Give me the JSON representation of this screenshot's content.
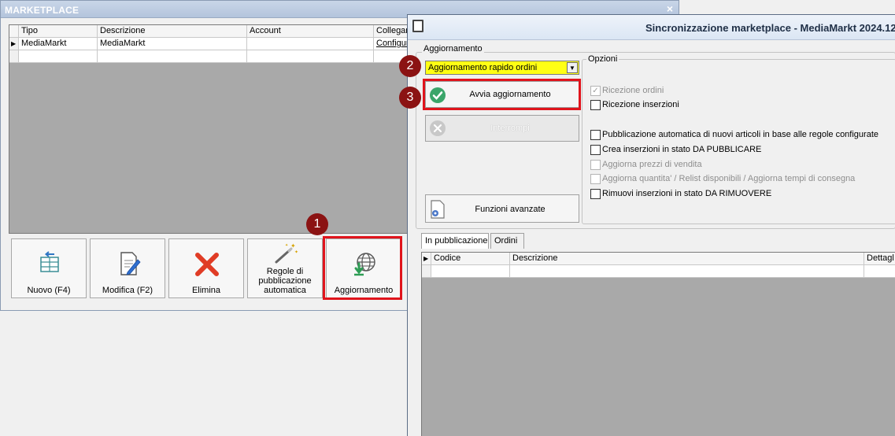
{
  "marketplace": {
    "title": "MARKETPLACE",
    "close_glyph": "×",
    "grid": {
      "columns": [
        "Tipo",
        "Descrizione",
        "Account",
        "Collegam"
      ],
      "rows": [
        {
          "tipo": "MediaMarkt",
          "descrizione": "MediaMarkt",
          "account": "",
          "collegamento": "Configur"
        }
      ]
    },
    "toolbar": {
      "nuovo": "Nuovo (F4)",
      "modifica": "Modifica (F2)",
      "elimina": "Elimina",
      "regole": "Regole di pubblicazione automatica",
      "aggiornamento": "Aggiornamento"
    }
  },
  "sync": {
    "title": "Sincronizzazione marketplace - MediaMarkt 2024.12",
    "group_label": "Aggiornamento",
    "combo_value": "Aggiornamento rapido ordini",
    "btn_avvia": "Avvia aggiornamento",
    "btn_interrompi": "Interrompi",
    "btn_funzioni": "Funzioni avanzate",
    "options_label": "Opzioni",
    "options": [
      {
        "label": "Ricezione ordini",
        "checked": true,
        "enabled": false
      },
      {
        "label": "Ricezione inserzioni",
        "checked": false,
        "enabled": true
      },
      {
        "label": "Pubblicazione automatica di nuovi articoli in base alle regole configurate",
        "checked": false,
        "enabled": true
      },
      {
        "label": "Crea inserzioni in stato DA PUBBLICARE",
        "checked": false,
        "enabled": true
      },
      {
        "label": "Aggiorna prezzi di vendita",
        "checked": false,
        "enabled": false
      },
      {
        "label": "Aggiorna quantita' / Relist disponibili / Aggiorna tempi di consegna",
        "checked": false,
        "enabled": false
      },
      {
        "label": "Rimuovi inserzioni in stato DA RIMUOVERE",
        "checked": false,
        "enabled": true
      }
    ],
    "tabs": [
      "In pubblicazione",
      "Ordini"
    ],
    "grid_columns": [
      "Codice",
      "Descrizione",
      "Dettagl"
    ]
  },
  "annotations": {
    "step1": "1",
    "step2": "2",
    "step3": "3",
    "color": "#8b1313",
    "box_color": "#e0141c"
  },
  "colors": {
    "combo_highlight": "#ffff14",
    "grid_background": "#a9a9a9"
  }
}
